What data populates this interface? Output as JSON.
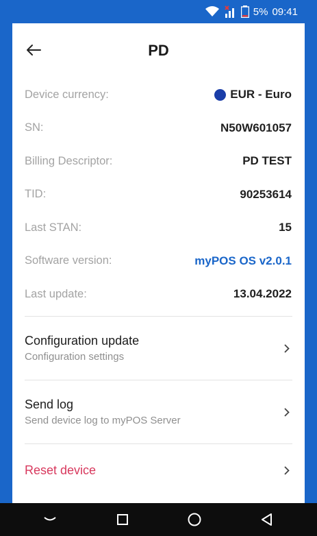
{
  "status_bar": {
    "battery": "5%",
    "time": "09:41",
    "icons": [
      "wifi-icon",
      "no-signal-icon",
      "battery-icon"
    ]
  },
  "header": {
    "title": "PD",
    "back_icon": "back-arrow-icon"
  },
  "info": {
    "rows": [
      {
        "label": "Device currency:",
        "value": "EUR - Euro"
      },
      {
        "label": "SN:",
        "value": "N50W601057"
      },
      {
        "label": "Billing Descriptor:",
        "value": "PD TEST"
      },
      {
        "label": "TID:",
        "value": "90253614"
      },
      {
        "label": "Last STAN:",
        "value": "15"
      },
      {
        "label": "Software version:",
        "value": "myPOS OS v2.0.1"
      },
      {
        "label": "Last update:",
        "value": "13.04.2022"
      }
    ]
  },
  "menu": {
    "config_title": "Configuration update",
    "config_sub": "Configuration settings",
    "sendlog_title": "Send log",
    "sendlog_sub": "Send device log to myPOS Server",
    "reset_title": "Reset device"
  },
  "colors": {
    "brand": "#1a66c9",
    "danger": "#d8385d",
    "label": "#a3a3a3"
  },
  "navbar": {
    "icons": [
      "hide-keyboard-icon",
      "recents-icon",
      "home-icon",
      "back-icon"
    ]
  }
}
